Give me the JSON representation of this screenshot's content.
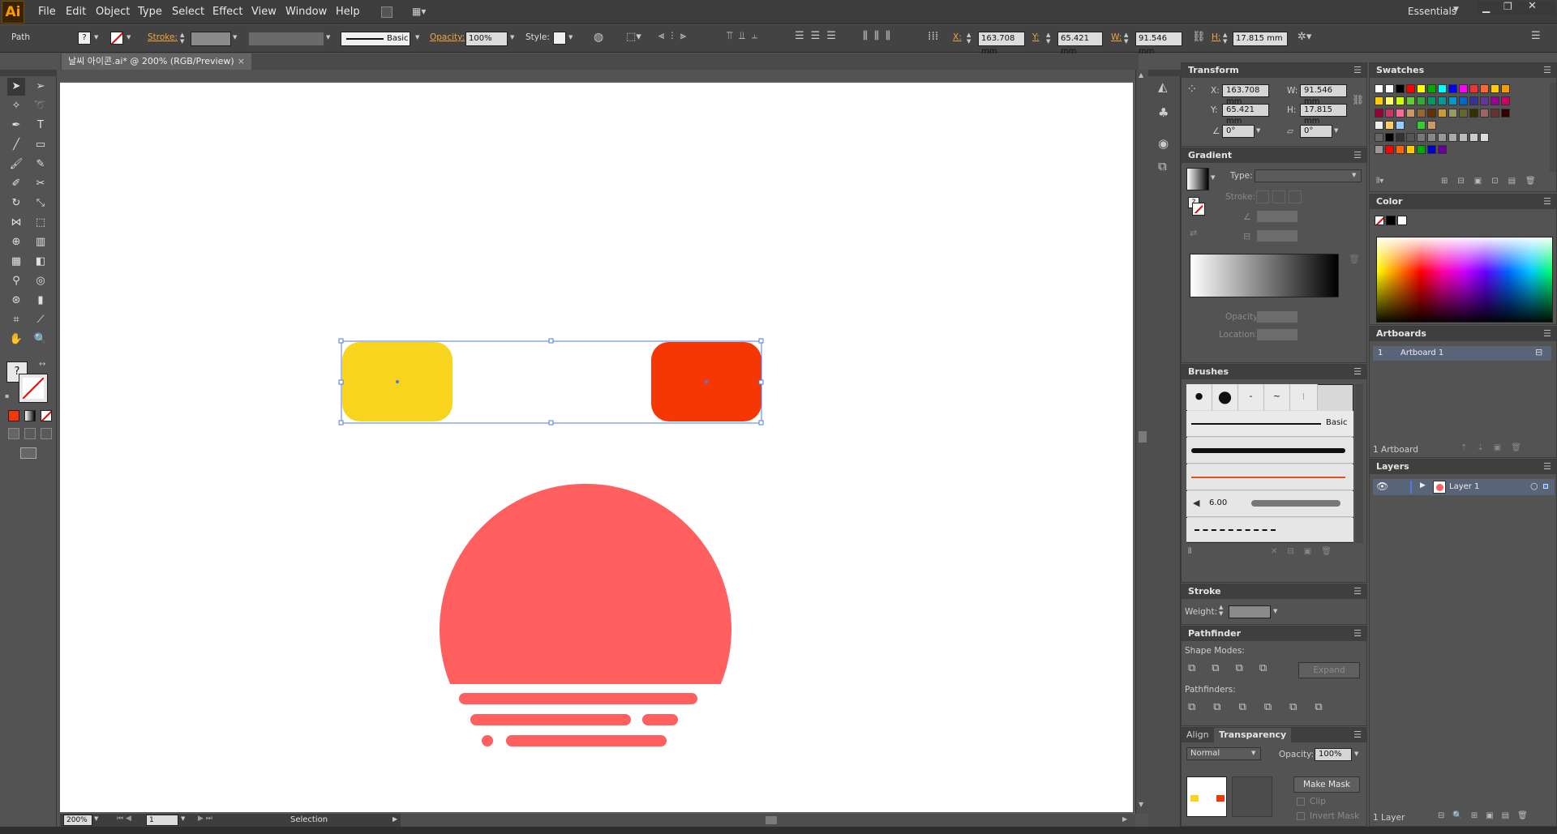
{
  "menu": [
    "File",
    "Edit",
    "Object",
    "Type",
    "Select",
    "Effect",
    "View",
    "Window",
    "Help"
  ],
  "app_logo": "Ai",
  "workspace": "Essentials",
  "window_controls": [
    "minimize",
    "restore",
    "close"
  ],
  "control_bar": {
    "selection_type": "Path",
    "stroke_label": "Stroke:",
    "brush": "Basic",
    "opacity_label": "Opacity:",
    "opacity": "100%",
    "style_label": "Style:",
    "x_label": "X:",
    "x": "163.708 mm",
    "y_label": "Y:",
    "y": "65.421 mm",
    "w_label": "W:",
    "w": "91.546 mm",
    "h_label": "H:",
    "h": "17.815 mm"
  },
  "document_tab": {
    "title": "날씨 아이콘.ai* @ 200% (RGB/Preview)",
    "close": "×"
  },
  "artwork": {
    "yellow": "#f8d41f",
    "red": "#f53605",
    "sun": "#ff5f5f",
    "selection_color": "#4f7be0"
  },
  "status": {
    "zoom": "200%",
    "artboard": "1",
    "tool": "Selection"
  },
  "transform_panel": {
    "title": "Transform",
    "x_label": "X:",
    "x": "163.708 mm",
    "y_label": "Y:",
    "y": "65.421 mm",
    "w_label": "W:",
    "w": "91.546 mm",
    "h_label": "H:",
    "h": "17.815 mm",
    "rotate": "0°",
    "shear": "0°"
  },
  "gradient_panel": {
    "title": "Gradient",
    "type_label": "Type:",
    "stroke_label": "Stroke:",
    "opacity_label": "Opacity:",
    "location_label": "Location:"
  },
  "brushes_panel": {
    "title": "Brushes",
    "basic": "Basic",
    "size": "6.00"
  },
  "stroke_panel": {
    "title": "Stroke",
    "weight_label": "Weight:"
  },
  "pathfinder_panel": {
    "title": "Pathfinder",
    "shape_modes": "Shape Modes:",
    "pathfinders": "Pathfinders:",
    "expand": "Expand"
  },
  "transparency_panel": {
    "tab_align": "Align",
    "tab_transparency": "Transparency",
    "mode": "Normal",
    "opacity_label": "Opacity:",
    "opacity": "100%",
    "make_mask": "Make Mask",
    "clip": "Clip",
    "invert_mask": "Invert Mask"
  },
  "swatches_panel": {
    "title": "Swatches"
  },
  "color_panel": {
    "title": "Color"
  },
  "artboards_panel": {
    "title": "Artboards",
    "index": "1",
    "name": "Artboard 1",
    "count": "1 Artboard"
  },
  "layers_panel": {
    "title": "Layers",
    "layer_name": "Layer 1",
    "count": "1 Layer"
  }
}
